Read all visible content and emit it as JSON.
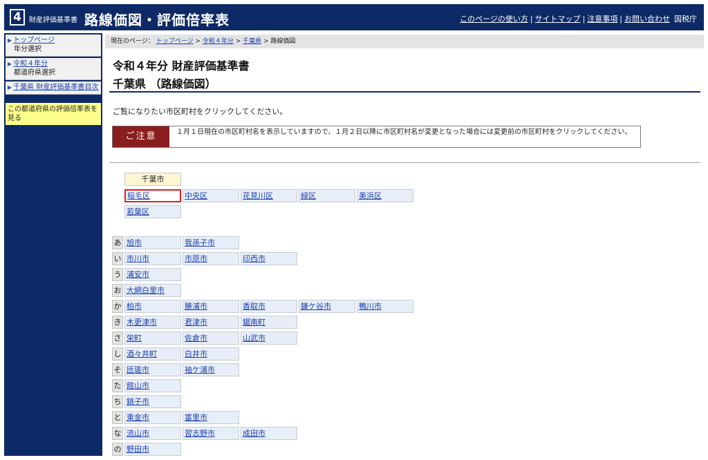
{
  "header": {
    "logo_number": "4",
    "site_name": "財産評価基準書",
    "title": "路線価図・評価倍率表",
    "links": [
      "このページの使い方",
      "サイトマップ",
      "注意事項",
      "お問い合わせ"
    ],
    "agency": "国税庁"
  },
  "sidebar": {
    "items": [
      {
        "link": "トップページ",
        "sub": "年分選択"
      },
      {
        "link": "令和４年分",
        "sub": "都道府県選択"
      },
      {
        "link": "千葉県 財産評価基準書目次",
        "sub": ""
      }
    ],
    "note": "この都道府県の評価倍率表を見る"
  },
  "breadcrumb": {
    "prefix": "現在のページ：",
    "items": [
      "トップページ",
      "令和４年分",
      "千葉県"
    ],
    "current": "路線価図"
  },
  "main": {
    "title_line1": "令和４年分 財産評価基準書",
    "title_line2": "千葉県 （路線価図）",
    "instruction": "ご覧になりたい市区町村をクリックしてください。",
    "caution_label": "ご注意",
    "caution_text": "１月１日現在の市区町村名を表示していますので、１月２日以降に市区町村名が変更となった場合には変更前の市区町村をクリックしてください。"
  },
  "city_section": {
    "header": "千葉市",
    "wards": [
      "稲毛区",
      "中央区",
      "花見川区",
      "緑区",
      "美浜区",
      "若葉区"
    ],
    "highlighted": "稲毛区"
  },
  "municipality_rows": [
    {
      "kana": "あ",
      "items": [
        "旭市",
        "我孫子市"
      ]
    },
    {
      "kana": "い",
      "items": [
        "市川市",
        "市原市",
        "印西市"
      ]
    },
    {
      "kana": "う",
      "items": [
        "浦安市"
      ]
    },
    {
      "kana": "お",
      "items": [
        "大網白里市"
      ]
    },
    {
      "kana": "か",
      "items": [
        "柏市",
        "勝浦市",
        "香取市",
        "鎌ケ谷市",
        "鴨川市"
      ]
    },
    {
      "kana": "き",
      "items": [
        "木更津市",
        "君津市",
        "鋸南町"
      ]
    },
    {
      "kana": "さ",
      "items": [
        "栄町",
        "佐倉市",
        "山武市"
      ]
    },
    {
      "kana": "し",
      "items": [
        "酒々井町",
        "白井市"
      ]
    },
    {
      "kana": "そ",
      "items": [
        "匝瑳市",
        "袖ケ浦市"
      ]
    },
    {
      "kana": "た",
      "items": [
        "館山市"
      ]
    },
    {
      "kana": "ち",
      "items": [
        "銚子市"
      ]
    },
    {
      "kana": "と",
      "items": [
        "東金市",
        "富里市"
      ]
    },
    {
      "kana": "な",
      "items": [
        "流山市",
        "習志野市",
        "成田市"
      ]
    },
    {
      "kana": "の",
      "items": [
        "野田市"
      ]
    }
  ]
}
